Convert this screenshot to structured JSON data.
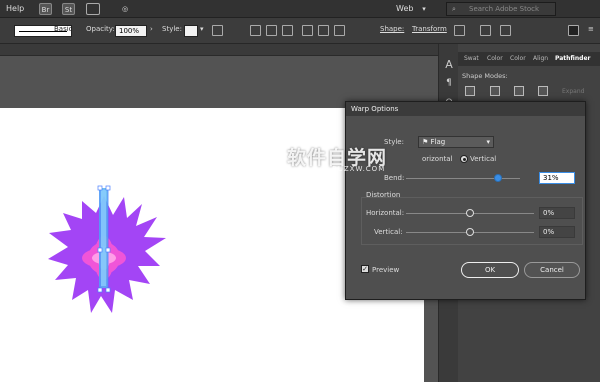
{
  "menubar": {
    "help": "Help",
    "br": "Br",
    "st": "St",
    "workspace": "Web",
    "search_placeholder": "Search Adobe Stock"
  },
  "control": {
    "stroke_style": "Basic",
    "opacity_label": "Opacity:",
    "opacity_value": "100%",
    "style_label": "Style:",
    "shape_label": "Shape:",
    "transform_label": "Transform"
  },
  "panel": {
    "tabs": [
      "Swat",
      "Color",
      "Color",
      "Align",
      "Pathfinder"
    ],
    "active_tab": "Pathfinder",
    "shape_modes": "Shape Modes:",
    "expand": "Expand"
  },
  "dialog": {
    "title": "Warp Options",
    "style_label": "Style:",
    "style_value": "Flag",
    "horizontal_label": "orizontal",
    "vertical_label": "Vertical",
    "bend_label": "Bend:",
    "bend_value": "31%",
    "bend_fraction": 0.81,
    "distortion_title": "Distortion",
    "dist_h_label": "Horizontal:",
    "dist_h_value": "0%",
    "dist_v_label": "Vertical:",
    "dist_v_value": "0%",
    "preview_label": "Preview",
    "ok_label": "OK",
    "cancel_label": "Cancel"
  },
  "watermark": {
    "main": "软件自学网",
    "sub": "RUZXW.COM"
  },
  "colors": {
    "star_outer": "#a345f5",
    "star_inner": "#f055d8",
    "star_core": "#ff9ee8",
    "strap": "#59b4f0",
    "accent": "#3a8ee6"
  }
}
